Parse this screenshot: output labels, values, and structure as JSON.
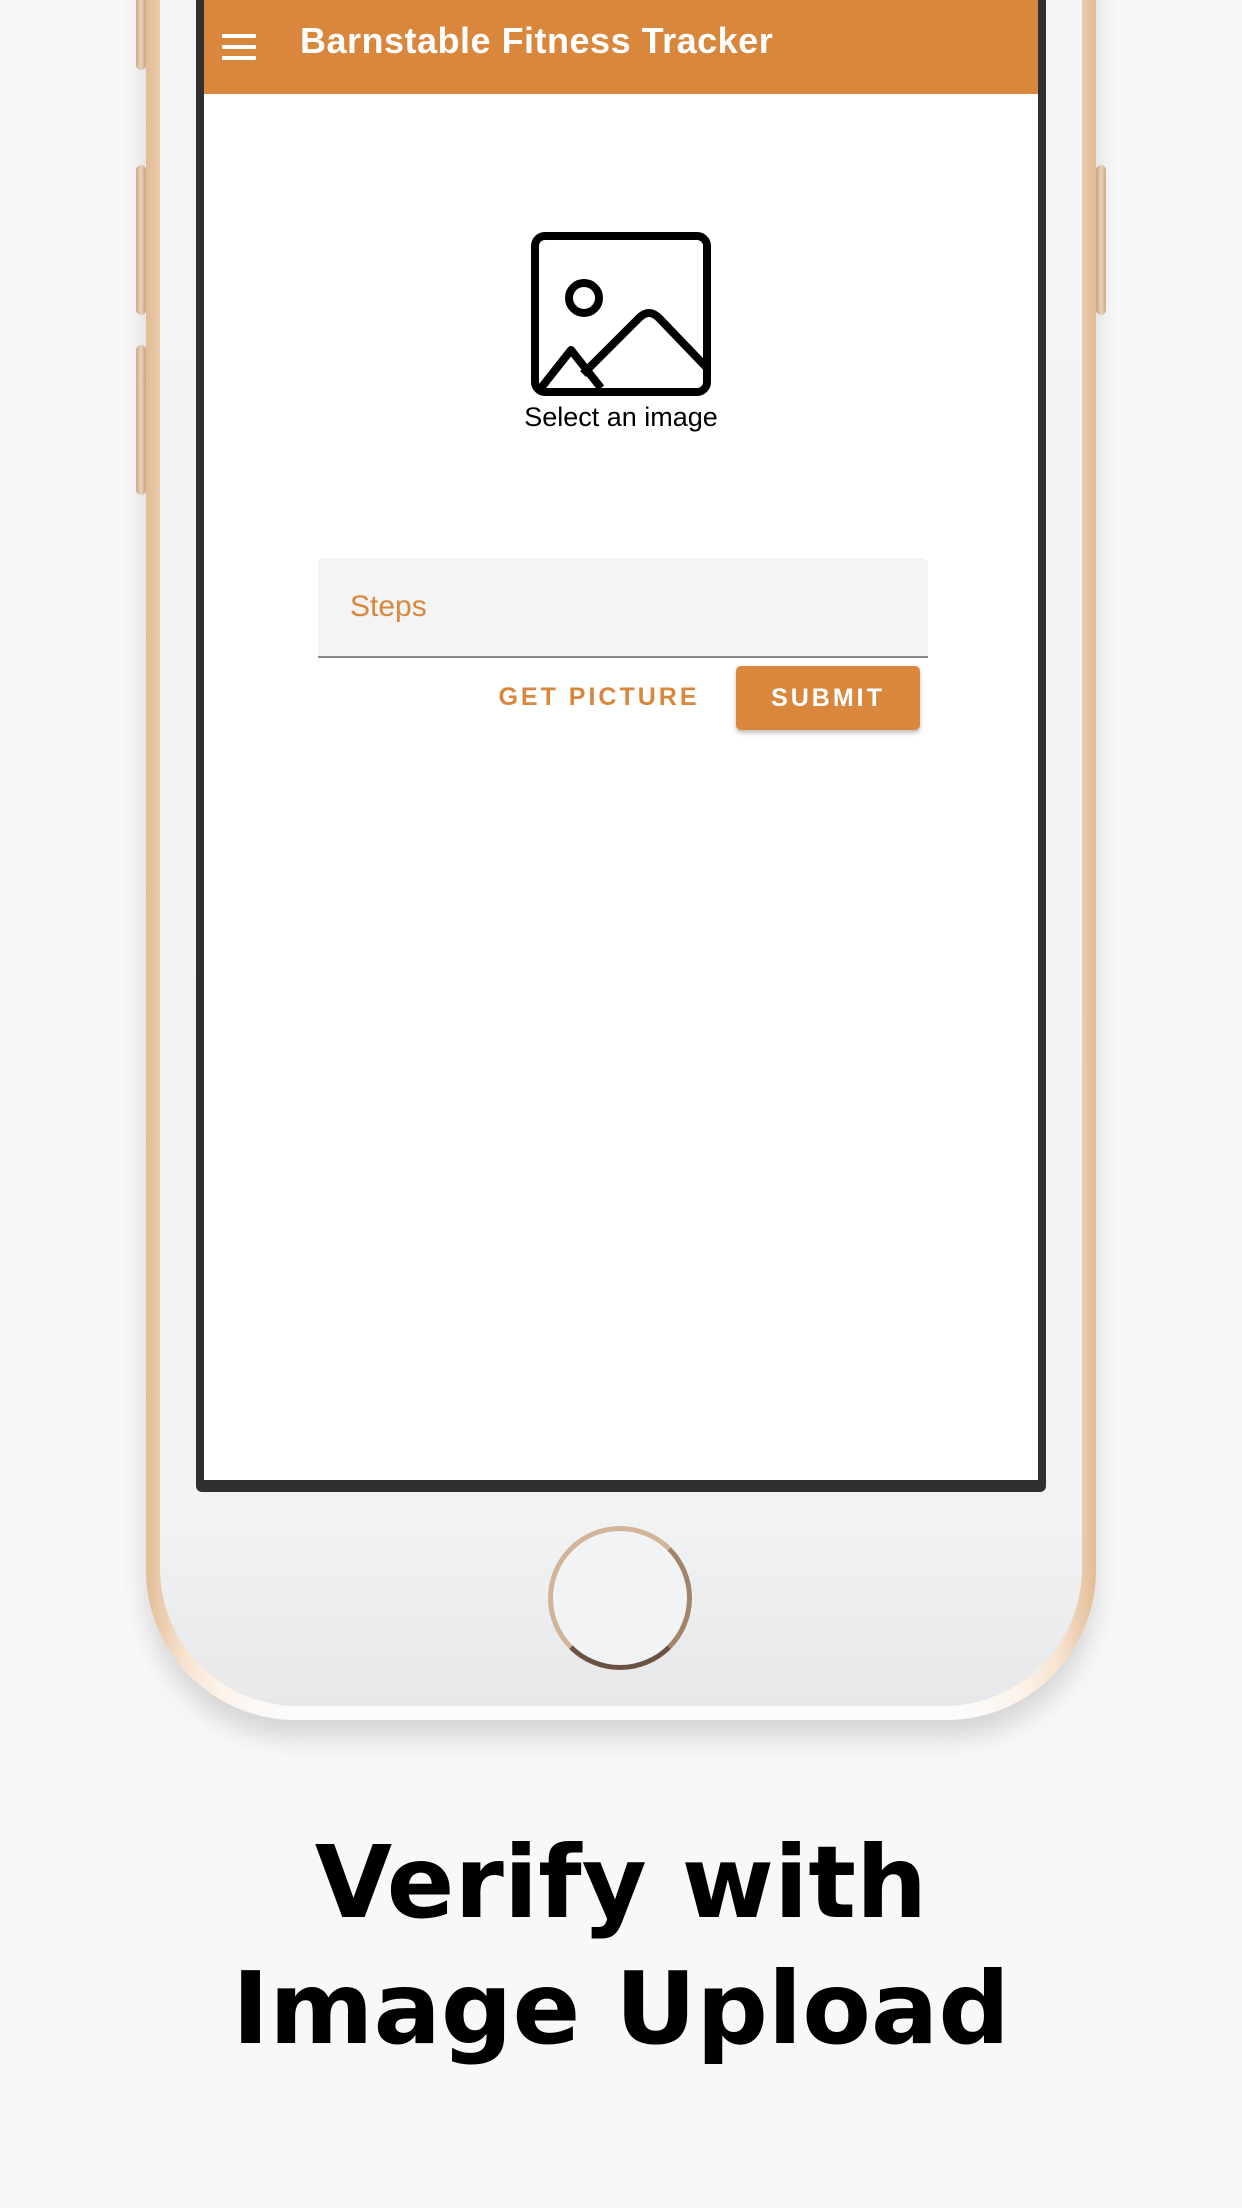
{
  "app": {
    "title": "Barnstable Fitness Tracker",
    "menu_icon": "hamburger-menu-icon",
    "accent_color": "#d8873d"
  },
  "image_picker": {
    "icon": "image-placeholder-icon",
    "caption": "Select an image"
  },
  "steps_input": {
    "placeholder": "Steps",
    "value": ""
  },
  "actions": {
    "get_picture_label": "GET PICTURE",
    "submit_label": "SUBMIT"
  },
  "promo": {
    "line1": "Verify with",
    "line2": "Image Upload"
  }
}
